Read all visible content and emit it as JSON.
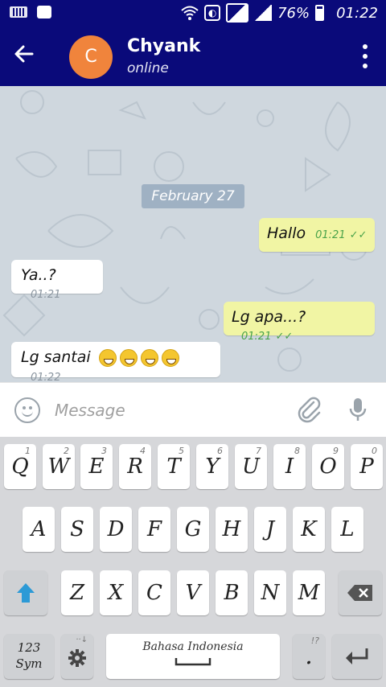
{
  "status_bar": {
    "battery": "76%",
    "time": "01:22"
  },
  "header": {
    "avatar_letter": "C",
    "contact_name": "Chyank",
    "contact_status": "online",
    "back_icon": "arrow-left-icon",
    "menu_icon": "more-vert-icon"
  },
  "chat": {
    "date_separator": "February 27",
    "messages": [
      {
        "direction": "out",
        "text": "Hallo",
        "time": "01:21",
        "ticks": "✓✓"
      },
      {
        "direction": "in",
        "text": "Ya..?",
        "time": "01:21"
      },
      {
        "direction": "out",
        "text": "Lg apa...?",
        "time": "01:21",
        "ticks": "✓✓"
      },
      {
        "direction": "in",
        "text": "Lg santai",
        "time": "01:22",
        "emoji_count": 4
      }
    ]
  },
  "input": {
    "placeholder": "Message",
    "emoji_icon": "smiley-icon",
    "attach_icon": "paperclip-icon",
    "mic_icon": "microphone-icon"
  },
  "keyboard": {
    "row1": [
      {
        "label": "Q",
        "hint": "1"
      },
      {
        "label": "W",
        "hint": "2"
      },
      {
        "label": "E",
        "hint": "3"
      },
      {
        "label": "R",
        "hint": "4"
      },
      {
        "label": "T",
        "hint": "5"
      },
      {
        "label": "Y",
        "hint": "6"
      },
      {
        "label": "U",
        "hint": "7"
      },
      {
        "label": "I",
        "hint": "8"
      },
      {
        "label": "O",
        "hint": "9"
      },
      {
        "label": "P",
        "hint": "0"
      }
    ],
    "row2": [
      "A",
      "S",
      "D",
      "F",
      "G",
      "H",
      "J",
      "K",
      "L"
    ],
    "row3": [
      "Z",
      "X",
      "C",
      "V",
      "B",
      "N",
      "M"
    ],
    "sym_label_1": "123",
    "sym_label_2": "Sym",
    "space_label": "Bahasa Indonesia",
    "period_label": ".",
    "period_hint": "!?"
  }
}
